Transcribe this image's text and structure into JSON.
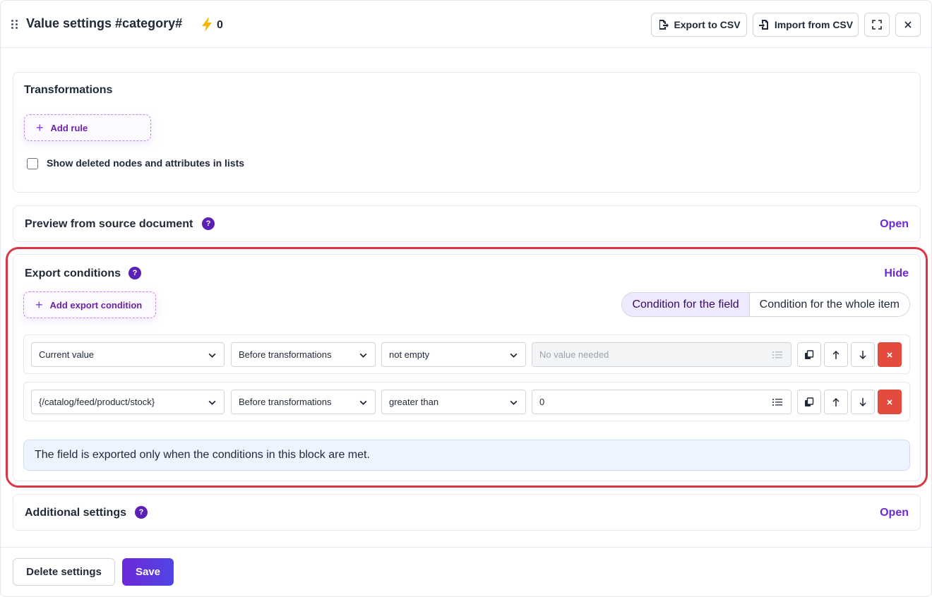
{
  "header": {
    "title": "Value settings #category#",
    "bolt_count": "0",
    "export_csv": "Export to CSV",
    "import_csv": "Import from CSV"
  },
  "transformations": {
    "title": "Transformations",
    "add_rule": "Add rule",
    "show_deleted": "Show deleted nodes and attributes in lists"
  },
  "preview": {
    "title": "Preview from source document",
    "action": "Open"
  },
  "export_conditions": {
    "title": "Export conditions",
    "action": "Hide",
    "add_condition": "Add export condition",
    "tabs": [
      "Condition for the field",
      "Condition for the whole item"
    ],
    "rows": [
      {
        "source": "Current value",
        "stage": "Before transformations",
        "operator": "not empty",
        "value": "",
        "value_placeholder": "No value needed"
      },
      {
        "source": "{/catalog/feed/product/stock}",
        "stage": "Before transformations",
        "operator": "greater than",
        "value": "0",
        "value_placeholder": ""
      }
    ],
    "info": "The field is exported only when the conditions in this block are met."
  },
  "additional": {
    "title": "Additional settings",
    "action": "Open"
  },
  "footer": {
    "delete": "Delete settings",
    "save": "Save"
  },
  "colors": {
    "accent": "#6d28d9",
    "danger": "#e34b3f",
    "highlight": "#dc3545"
  },
  "icons": {
    "help": "?",
    "plus": "+"
  }
}
